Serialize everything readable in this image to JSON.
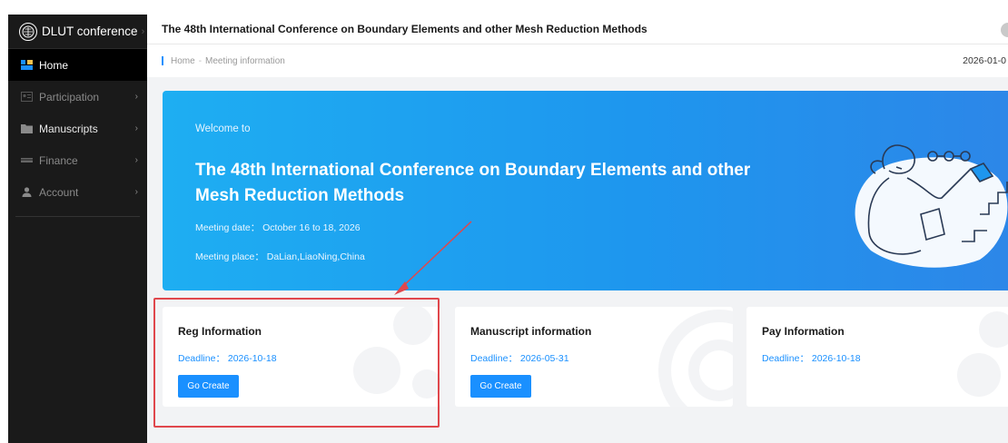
{
  "brand": {
    "name": "DLUT conference"
  },
  "sidebar": {
    "items": [
      {
        "label": "Home",
        "icon": "home-grid-icon"
      },
      {
        "label": "Participation",
        "icon": "participation-icon"
      },
      {
        "label": "Manuscripts",
        "icon": "folder-icon"
      },
      {
        "label": "Finance",
        "icon": "card-icon"
      },
      {
        "label": "Account",
        "icon": "user-icon"
      }
    ]
  },
  "header": {
    "title": "The 48th International Conference on Boundary Elements and other Mesh Reduction Methods"
  },
  "breadcrumb": {
    "home": "Home",
    "separator": "-",
    "current": "Meeting information",
    "date": "2026-01-0"
  },
  "banner": {
    "welcome": "Welcome to",
    "title": "The 48th International Conference on Boundary Elements and other Mesh Reduction Methods",
    "date_line": "Meeting date：  October 16 to 18, 2026",
    "place_line": "Meeting place：  DaLian,LiaoNing,China"
  },
  "cards": [
    {
      "title": "Reg Information",
      "deadline": "Deadline：  2026-10-18",
      "button": "Go Create"
    },
    {
      "title": "Manuscript information",
      "deadline": "Deadline：  2026-05-31",
      "button": "Go Create"
    },
    {
      "title": "Pay Information",
      "deadline": "Deadline：  2026-10-18"
    }
  ],
  "colors": {
    "accent": "#1a90ff",
    "sidebar_bg": "#1a1a1a",
    "banner_start": "#1eaef2",
    "banner_end": "#2d86e8",
    "annotation": "#e0474c"
  }
}
